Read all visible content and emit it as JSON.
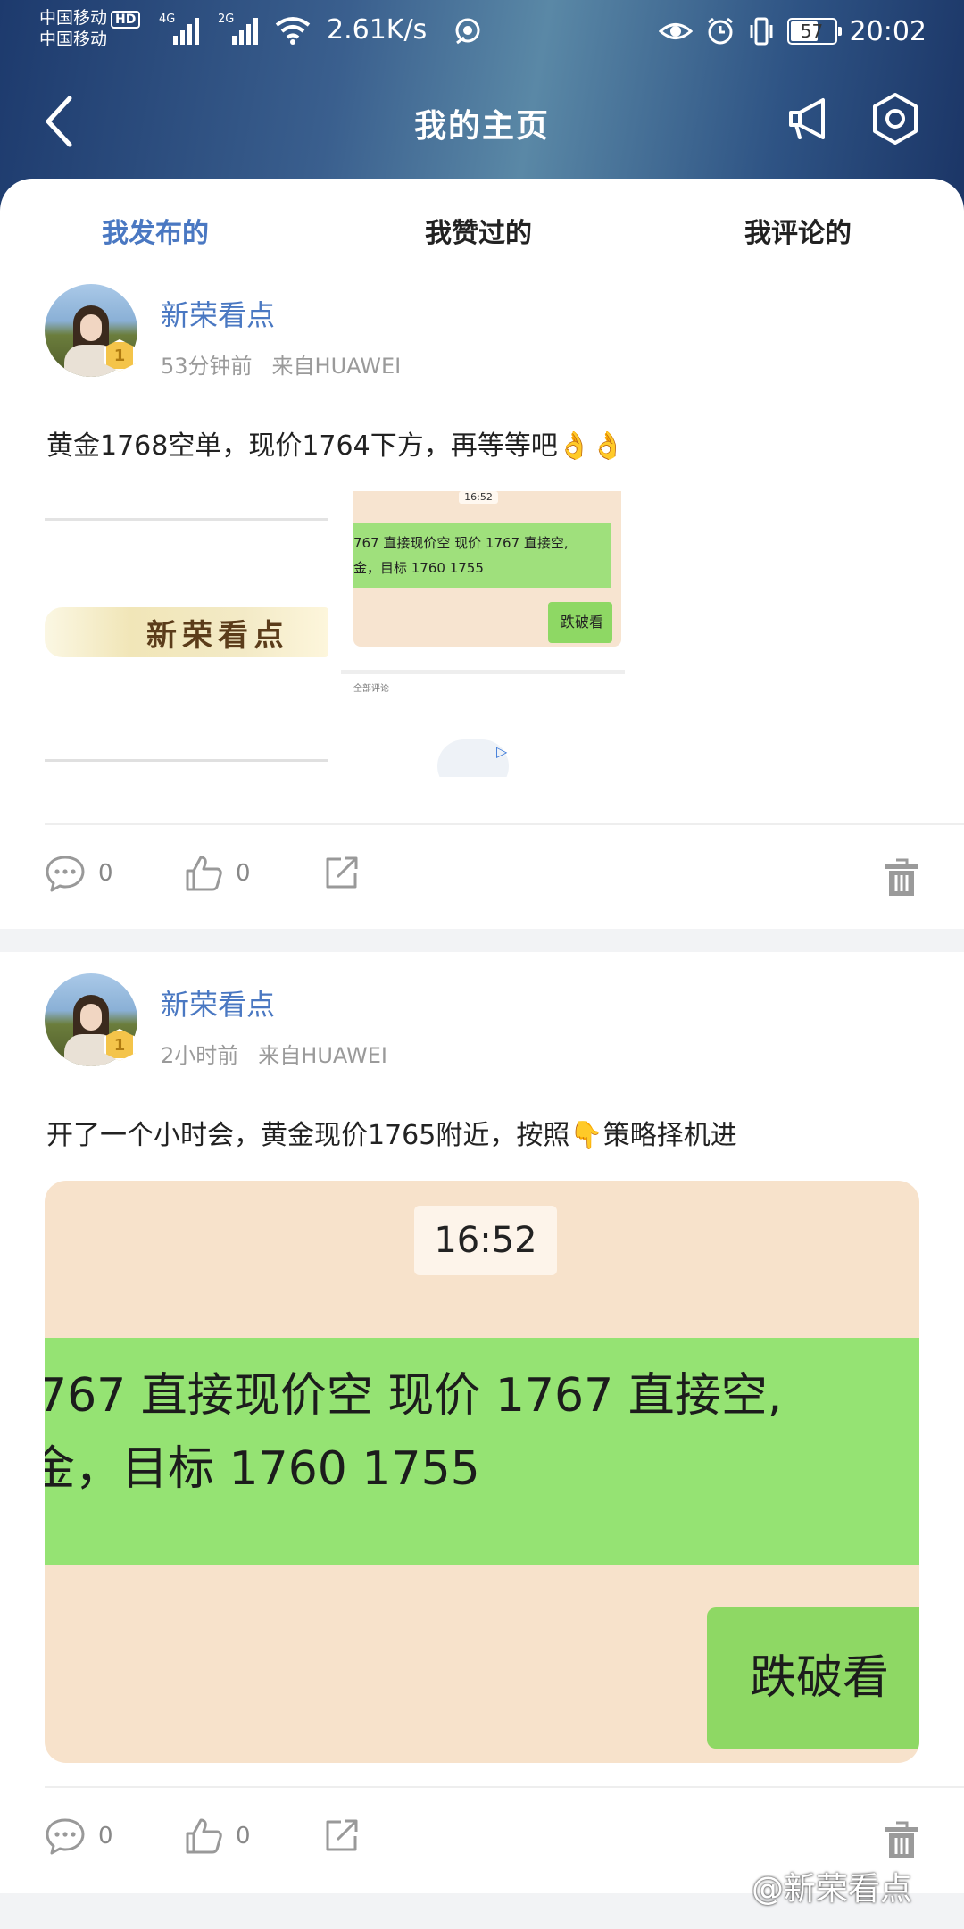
{
  "status_bar": {
    "carrier_1": "中国移动",
    "carrier_hd": "HD",
    "carrier_2": "中国移动",
    "net_4g": "4G",
    "net_2g": "2G",
    "speed": "2.61K/s",
    "battery": "57",
    "time": "20:02"
  },
  "header": {
    "title": "我的主页"
  },
  "tabs": [
    {
      "label": "我发布的",
      "active": true
    },
    {
      "label": "我赞过的",
      "active": false
    },
    {
      "label": "我评论的",
      "active": false
    }
  ],
  "posts": [
    {
      "author": "新荣看点",
      "level": "1",
      "time_ago": "53分钟前",
      "source": "来自HUAWEI",
      "text": "黄金1768空单，现价1764下方，再等等吧👌👌",
      "thumb_a": {
        "banner": "新荣看点"
      },
      "thumb_b": {
        "time": "16:52",
        "line1": "767 直接现价空  现价 1767 直接空,",
        "line2": "金，目标 1760  1755",
        "button": "跌破看",
        "comments_label": "全部评论"
      },
      "comments": "0",
      "likes": "0"
    },
    {
      "author": "新荣看点",
      "level": "1",
      "time_ago": "2小时前",
      "source": "来自HUAWEI",
      "text": "开了一个小时会，黄金现价1765附近，按照👇策略择机进",
      "image": {
        "time": "16:52",
        "line1": "767 直接现价空  现价 1767 直接空,",
        "line2": "金，目标 1760  1755",
        "button": "跌破看"
      },
      "comments": "0",
      "likes": "0"
    }
  ],
  "watermark": "@新荣看点",
  "colors": {
    "accent": "#4a78c2",
    "chat_green": "#95e373",
    "chat_bg": "#f7e2cb",
    "badge_gold": "#f4c44a"
  }
}
